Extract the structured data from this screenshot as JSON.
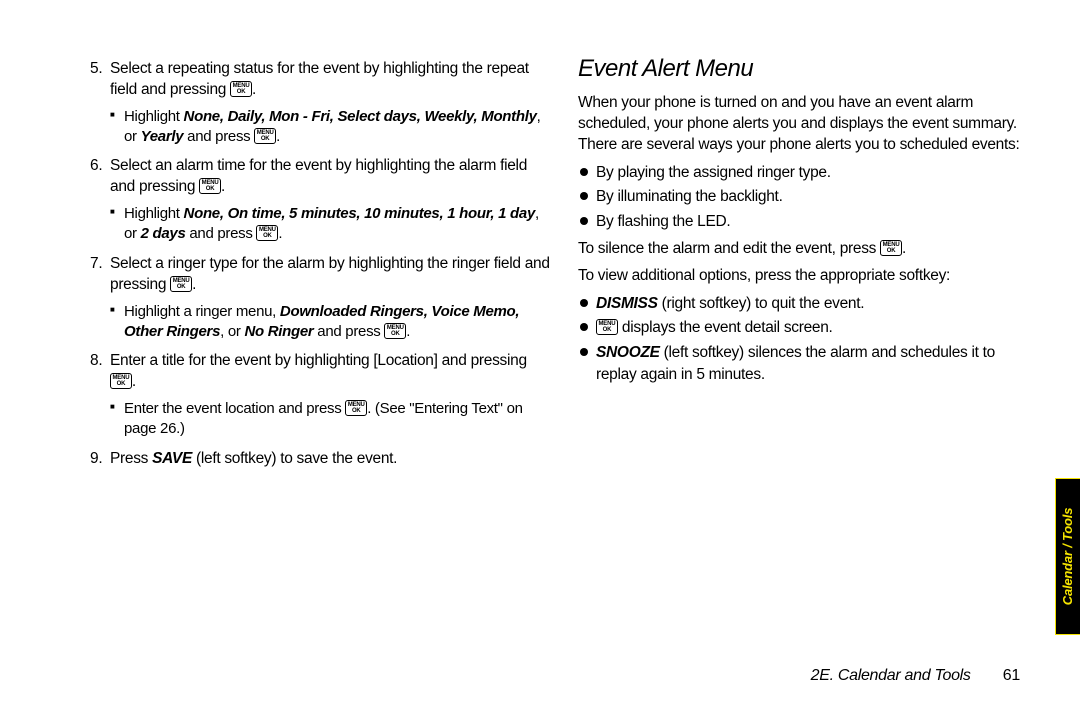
{
  "key": {
    "top": "MENU",
    "bot": "OK"
  },
  "left": {
    "items": [
      {
        "num": "5.",
        "text_a": "Select a repeating status for the event by highlighting the repeat field and pressing ",
        "text_b": ".",
        "sub_a": "Highlight ",
        "sub_b": "None, Daily, Mon - Fri, Select days, Weekly, Monthly",
        "sub_c": ", or ",
        "sub_d": "Yearly",
        "sub_e": " and press ",
        "sub_f": "."
      },
      {
        "num": "6.",
        "text_a": "Select an alarm time for the event by highlighting the alarm field and pressing ",
        "text_b": ".",
        "sub_a": "Highlight ",
        "sub_b": "None, On time, 5 minutes, 10 minutes, 1 hour, 1 day",
        "sub_c": ", or ",
        "sub_d": "2 days",
        "sub_e": " and press ",
        "sub_f": "."
      },
      {
        "num": "7.",
        "text_a": "Select a ringer type for the alarm by highlighting the ringer field and pressing ",
        "text_b": ".",
        "sub_a": "Highlight a ringer menu, ",
        "sub_b": "Downloaded Ringers, Voice Memo, Other Ringers",
        "sub_c": ", or ",
        "sub_d": "No Ringer",
        "sub_e": " and press ",
        "sub_f": "."
      },
      {
        "num": "8.",
        "text_a": "Enter a title for the event by highlighting [Location] and pressing ",
        "text_b": ".",
        "sub_a": "Enter the event location and press ",
        "sub_f": ". (See \"Entering Text\" on page 26.)"
      },
      {
        "num": "9.",
        "text_a": "Press ",
        "bold": "SAVE",
        "text_b": " (left softkey) to save the event."
      }
    ]
  },
  "right": {
    "heading": "Event Alert Menu",
    "intro": "When your phone is turned on and you have an event alarm scheduled, your phone alerts you and displays the event summary. There are several ways your phone alerts you to scheduled events:",
    "alerts": [
      "By playing the assigned ringer type.",
      "By illuminating the backlight.",
      "By flashing the LED."
    ],
    "silence_a": "To silence the alarm and edit the event, press ",
    "silence_b": ".",
    "view": "To view additional options, press the appropriate softkey:",
    "opts": {
      "dismiss_a": "DISMISS",
      "dismiss_b": " (right softkey) to quit the event.",
      "detail_b": " displays the event detail screen.",
      "snooze_a": "SNOOZE",
      "snooze_b": " (left softkey) silences the alarm and schedules it to replay again in 5 minutes."
    }
  },
  "tab": "Calendar / Tools",
  "footer": {
    "section": "2E. Calendar and Tools",
    "page": "61"
  }
}
